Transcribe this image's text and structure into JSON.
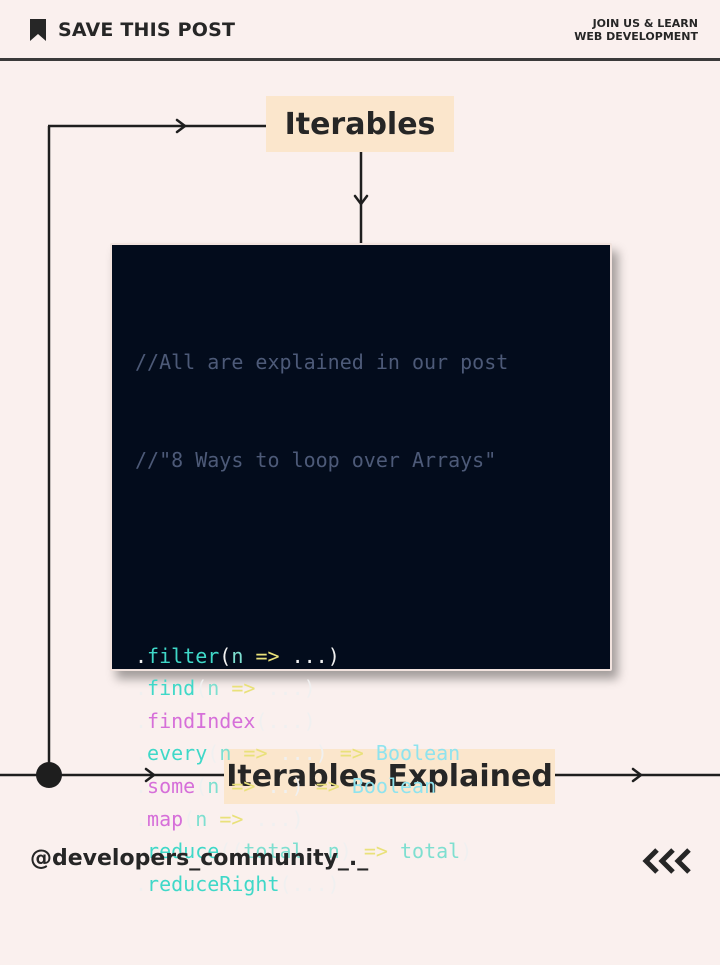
{
  "header": {
    "save_label": "SAVE THIS POST",
    "join_line1": "JOIN US & LEARN",
    "join_line2": "WEB DEVELOPMENT"
  },
  "diagram": {
    "top_label": "Iterables",
    "bottom_label": "Iterables Explained"
  },
  "code": {
    "comment1": "//All are explained in our post",
    "comment2": "//\"8 Ways to loop over Arrays\"",
    "lines": [
      {
        "method": "filter",
        "args": "n => ...",
        "suffix": ""
      },
      {
        "method": "find",
        "args": "n => ...",
        "suffix": ""
      },
      {
        "method": "findIndex",
        "args": "...",
        "suffix": ""
      },
      {
        "method": "every",
        "args": "n => ...",
        "suffix": "Boolean"
      },
      {
        "method": "some",
        "args": "n => ..",
        "suffix": "Boolean"
      },
      {
        "method": "map",
        "args": "n => ...",
        "suffix": ""
      },
      {
        "method": "reduce",
        "args": "(total, n) => total",
        "suffix": ""
      },
      {
        "method": "reduceRight",
        "args": "...",
        "suffix": ""
      }
    ]
  },
  "footer": {
    "handle": "@developers_community_._"
  },
  "colors": {
    "background": "#faf0ee",
    "label_fill": "#fbe6cc",
    "code_bg": "#030c1c",
    "ink": "#262626"
  },
  "icons": [
    "bookmark-icon",
    "chevrons-left-icon",
    "arrow-right-icon",
    "arrow-down-icon"
  ]
}
